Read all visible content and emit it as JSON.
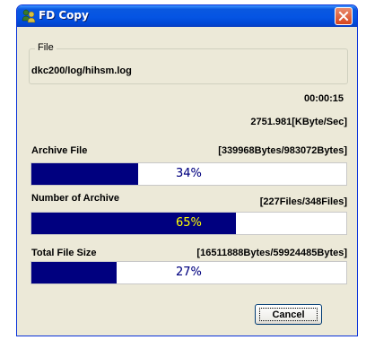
{
  "window": {
    "title": "FD Copy"
  },
  "file_group": {
    "legend": "File",
    "value": "dkc200/log/hihsm.log"
  },
  "elapsed_time": "00:00:15",
  "speed": "2751.981[KByte/Sec]",
  "progress": [
    {
      "label": "Archive File",
      "detail": "[339968Bytes/983072Bytes]",
      "percent_text": "34%",
      "fraction": 0.34
    },
    {
      "label": "Number of Archive",
      "detail": "[227Files/348Files]",
      "percent_text": "65%",
      "fraction": 0.65
    },
    {
      "label": "Total File Size",
      "detail": "[16511888Bytes/59924485Bytes]",
      "percent_text": "27%",
      "fraction": 0.27
    }
  ],
  "buttons": {
    "cancel": "Cancel"
  },
  "colors": {
    "titlebar": "#0554e3",
    "progress_fill": "#00007f",
    "dialog_bg": "#ece9d8",
    "close_button": "#d6451e"
  },
  "icons": {
    "app": "users-icon",
    "close": "close-icon"
  }
}
